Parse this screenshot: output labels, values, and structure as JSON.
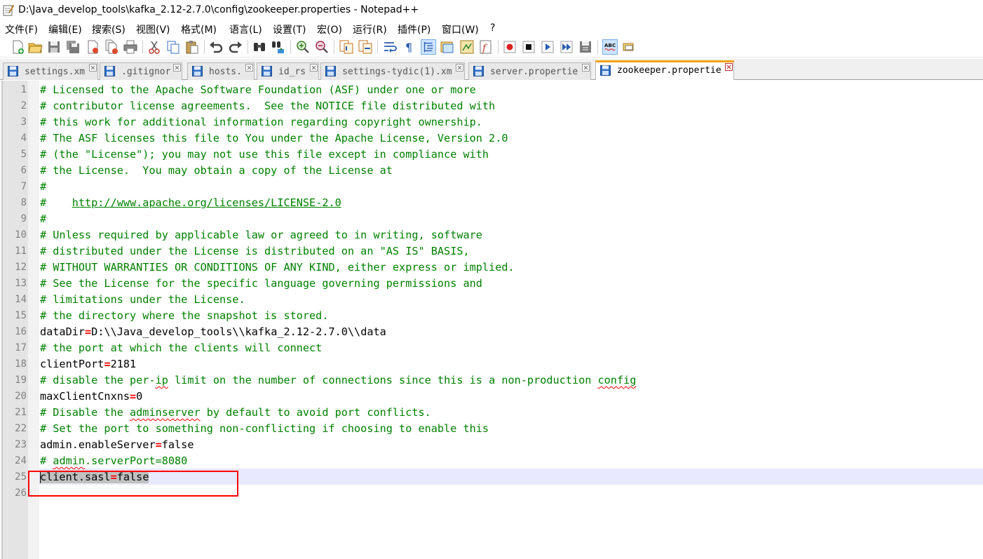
{
  "window": {
    "title": "D:\\Java_develop_tools\\kafka_2.12-2.7.0\\config\\zookeeper.properties - Notepad++"
  },
  "menu": [
    "文件(F)",
    "编辑(E)",
    "搜索(S)",
    "视图(V)",
    "格式(M)",
    "语言(L)",
    "设置(T)",
    "宏(O)",
    "运行(R)",
    "插件(P)",
    "窗口(W)",
    "?"
  ],
  "toolbar": {
    "icons": [
      "new-file-icon",
      "open-file-icon",
      "save-icon",
      "save-all-icon",
      "close-icon",
      "close-all-icon",
      "print-icon",
      "cut-icon",
      "copy-icon",
      "paste-icon",
      "undo-icon",
      "redo-icon",
      "find-icon",
      "replace-icon",
      "zoom-in-icon",
      "zoom-out-icon",
      "sync-vertical-icon",
      "sync-horizontal-icon",
      "word-wrap-icon",
      "show-all-chars-icon",
      "indent-guide-icon",
      "document-map-icon",
      "function-list-icon",
      "folder-workspace-icon",
      "record-macro-icon",
      "stop-macro-icon",
      "play-macro-icon",
      "run-macro-multiple-icon",
      "save-macro-icon",
      "spell-check-icon",
      "highlight-icon"
    ]
  },
  "tabs": [
    {
      "label": "settings.xm",
      "active": false
    },
    {
      "label": ".gitignor",
      "active": false
    },
    {
      "label": "hosts.",
      "active": false
    },
    {
      "label": "id_rs",
      "active": false
    },
    {
      "label": "settings-tydic(1).xm",
      "active": false
    },
    {
      "label": "server.propertie",
      "active": false
    },
    {
      "label": "zookeeper.propertie",
      "active": true
    }
  ],
  "editor": {
    "current_line": 25,
    "lines": [
      {
        "n": "1",
        "comment": "# Licensed to the Apache Software Foundation (ASF) under one or more"
      },
      {
        "n": "2",
        "comment": "# contributor license agreements.  See the NOTICE file distributed with"
      },
      {
        "n": "3",
        "comment": "# this work for additional information regarding copyright ownership."
      },
      {
        "n": "4",
        "comment": "# The ASF licenses this file to You under the Apache License, Version 2.0"
      },
      {
        "n": "5",
        "comment": "# (the \"License\"); you may not use this file except in compliance with"
      },
      {
        "n": "6",
        "comment": "# the License.  You may obtain a copy of the License at"
      },
      {
        "n": "7",
        "comment": "#"
      },
      {
        "n": "8",
        "comment_prefix": "#    ",
        "url": "http://www.apache.org/licenses/LICENSE-2.0"
      },
      {
        "n": "9",
        "comment": "#"
      },
      {
        "n": "10",
        "comment": "# Unless required by applicable law or agreed to in writing, software"
      },
      {
        "n": "11",
        "comment": "# distributed under the License is distributed on an \"AS IS\" BASIS,"
      },
      {
        "n": "12",
        "comment": "# WITHOUT WARRANTIES OR CONDITIONS OF ANY KIND, either express or implied."
      },
      {
        "n": "13",
        "comment": "# See the License for the specific language governing permissions and"
      },
      {
        "n": "14",
        "comment": "# limitations under the License."
      },
      {
        "n": "15",
        "comment": "# the directory where the snapshot is stored."
      },
      {
        "n": "16",
        "key": "dataDir",
        "eq": "=",
        "value": "D:\\\\Java_develop_tools\\\\kafka_2.12-2.7.0\\\\data"
      },
      {
        "n": "17",
        "comment": "# the port at which the clients will connect"
      },
      {
        "n": "18",
        "key": "clientPort",
        "eq": "=",
        "value": "2181"
      },
      {
        "n": "19",
        "c1": "# disable the per-",
        "sq1": "ip",
        "c2": " limit on the number of connections since this is a non-production ",
        "sq2": "config"
      },
      {
        "n": "20",
        "key": "maxClientCnxns",
        "eq": "=",
        "value": "0"
      },
      {
        "n": "21",
        "c1": "# Disable the ",
        "sq1": "adminserver",
        "c2": " by default to avoid port conflicts."
      },
      {
        "n": "22",
        "comment": "# Set the port to something non-conflicting if choosing to enable this"
      },
      {
        "n": "23",
        "key": "admin.enableServer",
        "eq": "=",
        "value": "false"
      },
      {
        "n": "24",
        "c1": "# ",
        "sq1": "admin",
        "c2": ".serverPort=8080"
      },
      {
        "n": "25",
        "key": "client.sasl",
        "eq": "=",
        "value": "false"
      },
      {
        "n": "26"
      }
    ]
  },
  "colors": {
    "comment": "#008000",
    "operator": "#ff0000",
    "current_line_bg": "#e8e8ff",
    "active_tab_accent": "#f5a300",
    "annotation": "#ff0000"
  }
}
